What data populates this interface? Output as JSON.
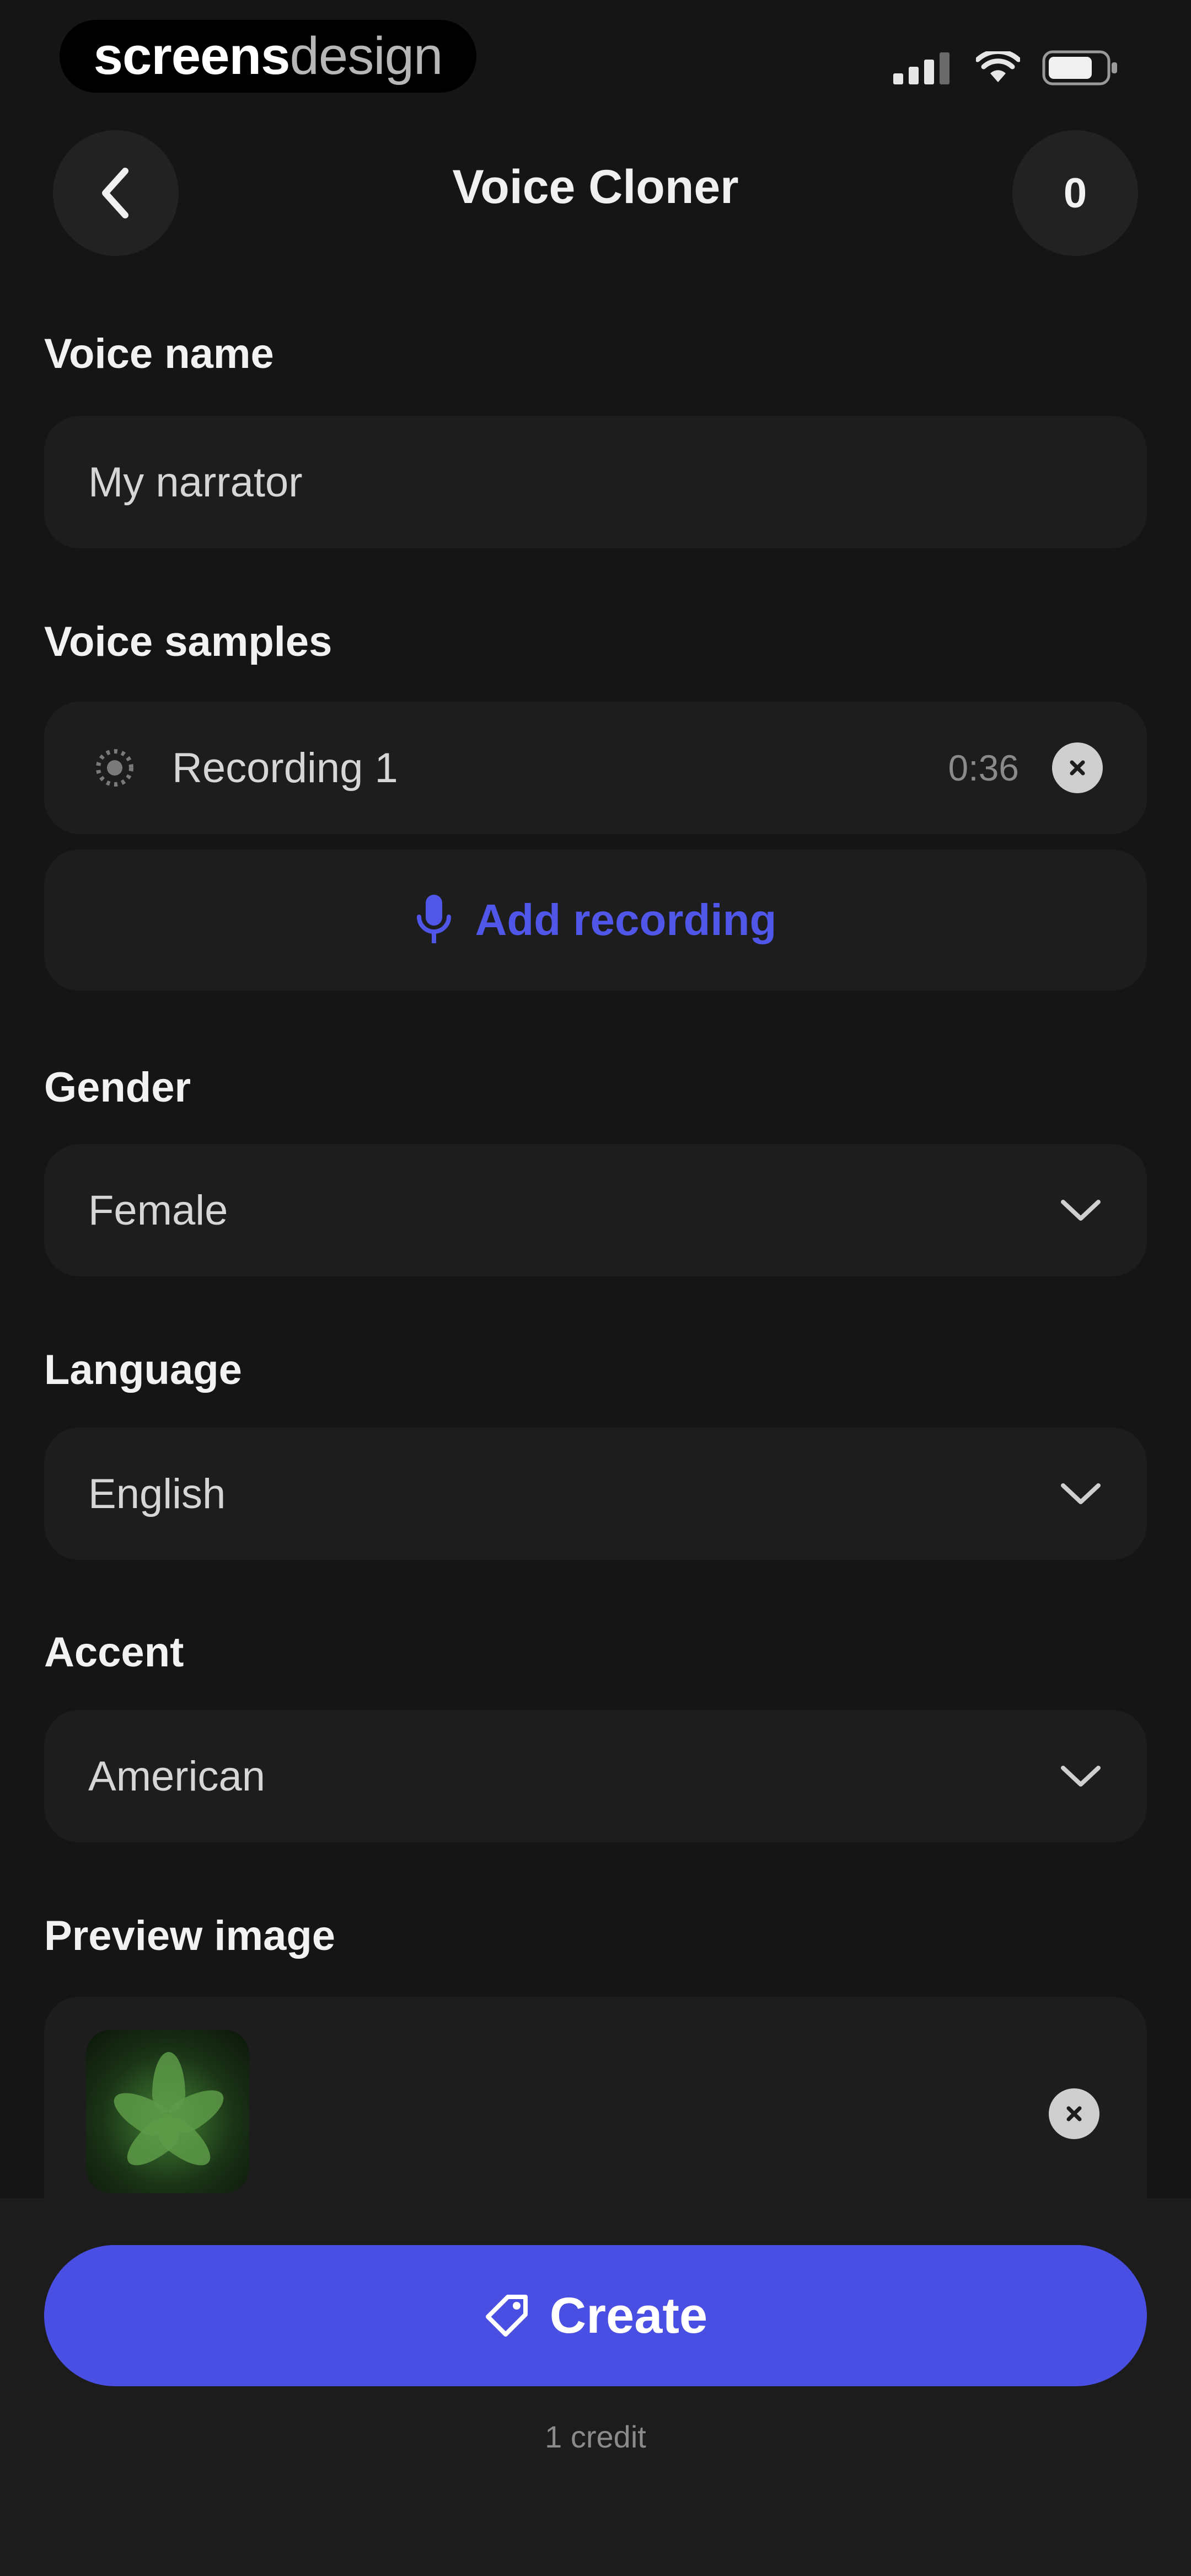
{
  "status_bar": {
    "brand_part1": "screens",
    "brand_part2": "design",
    "icons": [
      "signal-icon",
      "wifi-icon",
      "battery-icon"
    ]
  },
  "header": {
    "title": "Voice Cloner",
    "back_icon": "chevron-left-icon",
    "count": "0"
  },
  "form": {
    "voice_name": {
      "label": "Voice name",
      "value": "My narrator"
    },
    "voice_samples": {
      "label": "Voice samples",
      "recordings": [
        {
          "name": "Recording 1",
          "duration": "0:36"
        }
      ],
      "add_label": "Add recording"
    },
    "gender": {
      "label": "Gender",
      "value": "Female"
    },
    "language": {
      "label": "Language",
      "value": "English"
    },
    "accent": {
      "label": "Accent",
      "value": "American"
    },
    "preview_image": {
      "label": "Preview image"
    }
  },
  "footer": {
    "create_label": "Create",
    "credit_text": "1 credit"
  },
  "colors": {
    "background": "#151515",
    "field": "#1d1d1d",
    "accent": "#4a4fe3",
    "text": "#ececec"
  }
}
